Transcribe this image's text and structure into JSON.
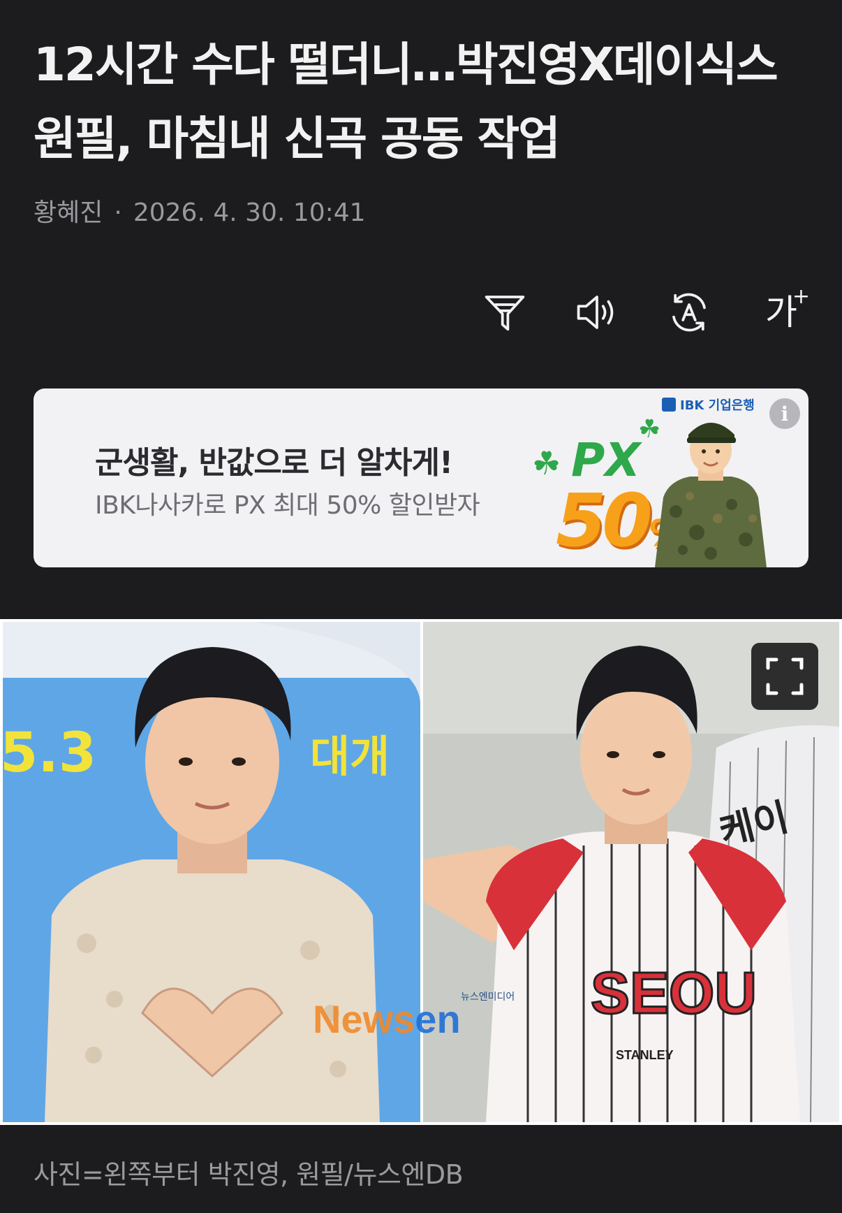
{
  "article": {
    "title": "12시간 수다 떨더니…박진영X데이식스 원필, 마침내 신곡 공동 작업",
    "author": "황혜진",
    "date": "2026. 4. 30. 10:41"
  },
  "toolbar": {
    "icons": [
      "filter-icon",
      "speaker-icon",
      "translate-icon",
      "font-size-icon"
    ],
    "font_size_glyph": "가",
    "font_size_plus": "+"
  },
  "ad": {
    "headline": "군생활, 반값으로 더 알차게!",
    "subline": "IBK나사카로 PX 최대 50% 할인받자",
    "brand": "IBK 기업은행",
    "promo_label": "PX",
    "promo_value": "50",
    "promo_unit": "%",
    "info_glyph": "i"
  },
  "photo": {
    "left_banner_text": "5.3",
    "left_banner_text2": "대개",
    "watermark_a": "News",
    "watermark_b": "en",
    "watermark_small": "뉴스엔미디어",
    "jersey_text": "SEOU",
    "jersey_sponsor": "STANLEY",
    "bg_jersey_text": "케이"
  },
  "caption": "사진=왼쪽부터 박진영, 원필/뉴스엔DB"
}
